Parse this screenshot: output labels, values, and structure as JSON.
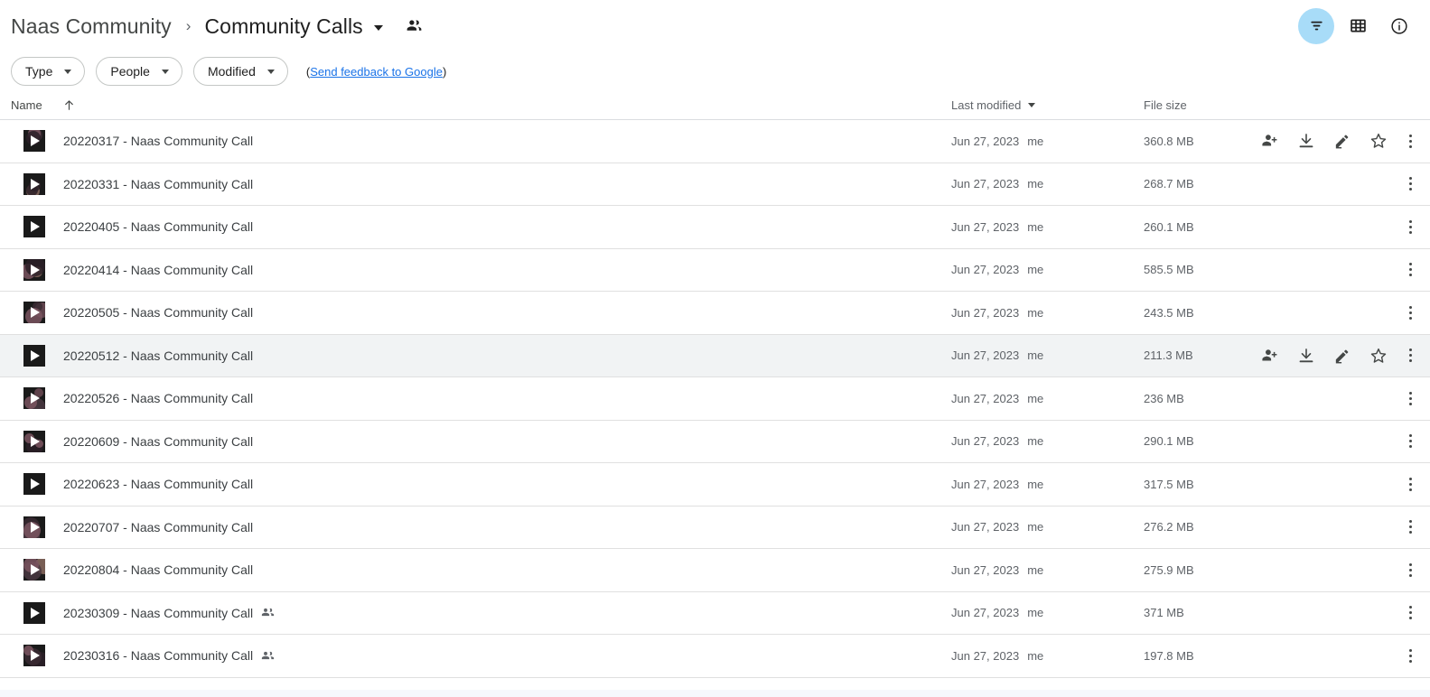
{
  "header": {
    "breadcrumb": [
      {
        "label": "Naas Community",
        "current": false
      },
      {
        "label": "Community Calls",
        "current": true
      }
    ],
    "separator": "›",
    "shared_folder_icon": "people-icon",
    "actions": [
      {
        "name": "filter-button",
        "icon": "filter-icon",
        "active": true
      },
      {
        "name": "grid-view-button",
        "icon": "grid-view-icon",
        "active": false
      },
      {
        "name": "details-button",
        "icon": "info-icon",
        "active": false
      }
    ]
  },
  "filters": {
    "chips": [
      {
        "label": "Type"
      },
      {
        "label": "People"
      },
      {
        "label": "Modified"
      }
    ],
    "feedback_open": "(",
    "feedback_link": "Send feedback to Google",
    "feedback_close": ")"
  },
  "table": {
    "columns": {
      "name": "Name",
      "name_sort_icon": "sort-ascending-icon",
      "last_modified": "Last modified",
      "last_modified_sorted": true,
      "file_size": "File size"
    },
    "row_actions": [
      {
        "name": "share-icon",
        "label": "Share"
      },
      {
        "name": "download-icon",
        "label": "Download"
      },
      {
        "name": "edit-icon",
        "label": "Edit"
      },
      {
        "name": "star-icon",
        "label": "Star"
      }
    ],
    "overflow_icon": "more-vert-icon",
    "rows": [
      {
        "name": "20220317 - Naas Community Call",
        "modified": "Jun 27, 2023",
        "owner": "me",
        "size": "360.8 MB",
        "shared": false,
        "hovered": false,
        "actions_visible": true
      },
      {
        "name": "20220331 - Naas Community Call",
        "modified": "Jun 27, 2023",
        "owner": "me",
        "size": "268.7 MB",
        "shared": false,
        "hovered": false,
        "actions_visible": false
      },
      {
        "name": "20220405 - Naas Community Call",
        "modified": "Jun 27, 2023",
        "owner": "me",
        "size": "260.1 MB",
        "shared": false,
        "hovered": false,
        "actions_visible": false
      },
      {
        "name": "20220414 - Naas Community Call",
        "modified": "Jun 27, 2023",
        "owner": "me",
        "size": "585.5 MB",
        "shared": false,
        "hovered": false,
        "actions_visible": false
      },
      {
        "name": "20220505 - Naas Community Call",
        "modified": "Jun 27, 2023",
        "owner": "me",
        "size": "243.5 MB",
        "shared": false,
        "hovered": false,
        "actions_visible": false
      },
      {
        "name": "20220512 - Naas Community Call",
        "modified": "Jun 27, 2023",
        "owner": "me",
        "size": "211.3 MB",
        "shared": false,
        "hovered": true,
        "actions_visible": true
      },
      {
        "name": "20220526 - Naas Community Call",
        "modified": "Jun 27, 2023",
        "owner": "me",
        "size": "236 MB",
        "shared": false,
        "hovered": false,
        "actions_visible": false
      },
      {
        "name": "20220609 - Naas Community Call",
        "modified": "Jun 27, 2023",
        "owner": "me",
        "size": "290.1 MB",
        "shared": false,
        "hovered": false,
        "actions_visible": false
      },
      {
        "name": "20220623 - Naas Community Call",
        "modified": "Jun 27, 2023",
        "owner": "me",
        "size": "317.5 MB",
        "shared": false,
        "hovered": false,
        "actions_visible": false
      },
      {
        "name": "20220707 - Naas Community Call",
        "modified": "Jun 27, 2023",
        "owner": "me",
        "size": "276.2 MB",
        "shared": false,
        "hovered": false,
        "actions_visible": false
      },
      {
        "name": "20220804 - Naas Community Call",
        "modified": "Jun 27, 2023",
        "owner": "me",
        "size": "275.9 MB",
        "shared": false,
        "hovered": false,
        "actions_visible": false
      },
      {
        "name": "20230309 - Naas Community Call",
        "modified": "Jun 27, 2023",
        "owner": "me",
        "size": "371 MB",
        "shared": true,
        "hovered": false,
        "actions_visible": false
      },
      {
        "name": "20230316 - Naas Community Call",
        "modified": "Jun 27, 2023",
        "owner": "me",
        "size": "197.8 MB",
        "shared": true,
        "hovered": false,
        "actions_visible": false
      }
    ]
  },
  "colors": {
    "accent_active": "#a8dcf8",
    "link": "#1a73e8",
    "row_hover": "#f1f3f4",
    "divider": "#e0e0e0",
    "text_primary": "#202124",
    "text_secondary": "#5f6368"
  }
}
